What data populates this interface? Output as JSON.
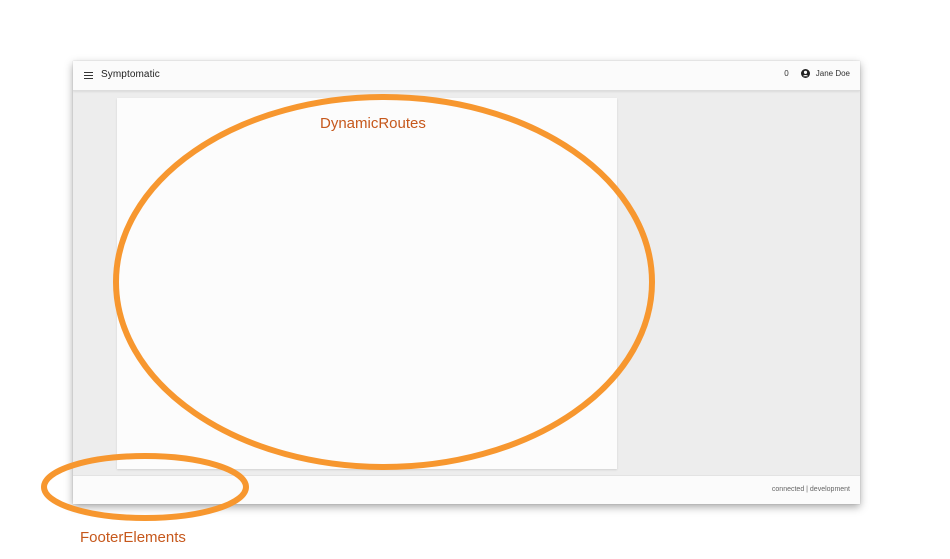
{
  "app": {
    "title": "Symptomatic"
  },
  "header": {
    "notification_count": "0",
    "user_name": "Jane Doe"
  },
  "footer": {
    "status_text": "connected | development"
  },
  "annotations": {
    "dynamic_routes_label": "DynamicRoutes",
    "footer_elements_label": "FooterElements",
    "ellipse_color": "#f7972f",
    "label_color": "#c6581c"
  },
  "icons": {
    "menu": "hamburger-menu-icon",
    "user": "user-circle-icon"
  }
}
